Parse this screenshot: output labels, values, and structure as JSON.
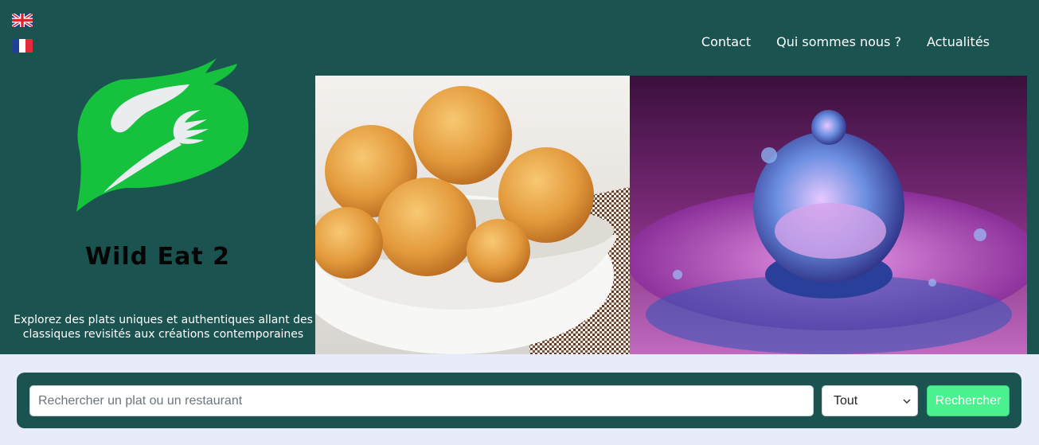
{
  "languages": [
    {
      "code": "en",
      "icon": "uk-flag-icon"
    },
    {
      "code": "fr",
      "icon": "france-flag-icon"
    }
  ],
  "nav": {
    "contact": "Contact",
    "about": "Qui sommes nous ?",
    "news": "Actualités"
  },
  "brand": {
    "name": "Wild Eat 2",
    "tagline": "Explorez des plats uniques et authentiques allant des classiques revisités aux créations contemporaines"
  },
  "search": {
    "placeholder": "Rechercher un plat ou un restaurant",
    "value": "",
    "category_selected": "Tout",
    "button_label": "Rechercher"
  },
  "colors": {
    "header_bg": "#1b5350",
    "page_bg": "#e8ebfa",
    "logo_green": "#16c13d",
    "button_green": "#4bf08f"
  }
}
